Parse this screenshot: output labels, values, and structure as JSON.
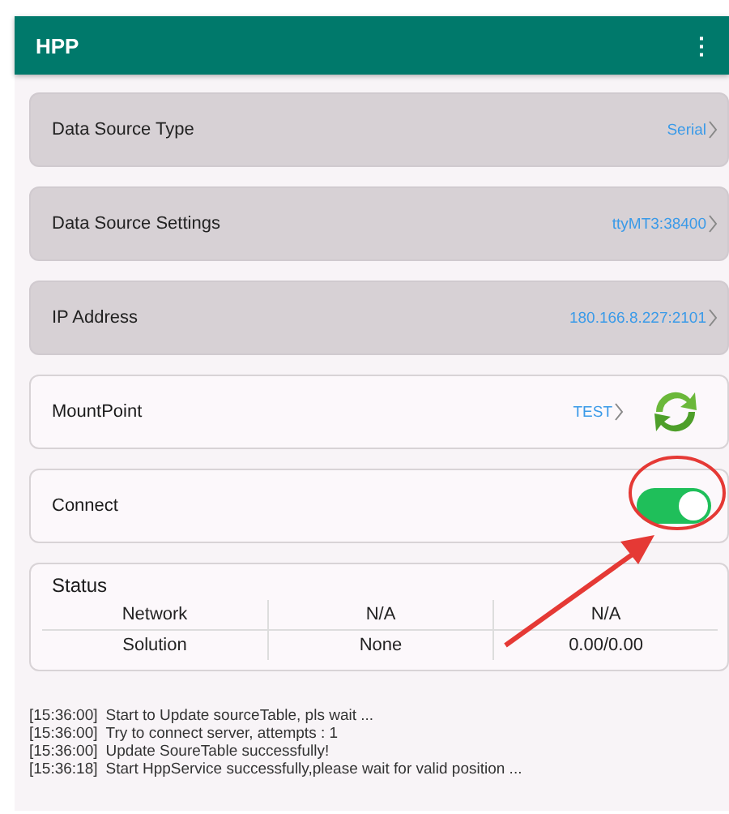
{
  "app_bar": {
    "title": "HPP",
    "menu_icon": "⋮"
  },
  "settings": [
    {
      "kind": "value",
      "label": "Data Source Type",
      "value": "Serial",
      "disabled": true
    },
    {
      "kind": "value",
      "label": "Data Source Settings",
      "value": "ttyMT3:38400",
      "disabled": true
    },
    {
      "kind": "value",
      "label": "IP Address",
      "value": "180.166.8.227:2101",
      "disabled": true
    },
    {
      "kind": "refresh",
      "label": "MountPoint",
      "value": "TEST",
      "disabled": false
    },
    {
      "kind": "toggle",
      "label": "Connect",
      "on": true,
      "disabled": false
    }
  ],
  "status": {
    "title": "Status",
    "rows": [
      {
        "cells": [
          "Network",
          "N/A",
          "N/A"
        ]
      },
      {
        "cells": [
          "Solution",
          "None",
          "0.00/0.00"
        ]
      }
    ]
  },
  "log": [
    {
      "time": "[15:36:00]",
      "message": "Start to Update sourceTable, pls wait ..."
    },
    {
      "time": "[15:36:00]",
      "message": "Try to connect server, attempts : 1"
    },
    {
      "time": "[15:36:00]",
      "message": "Update SoureTable successfully!"
    },
    {
      "time": "[15:36:18]",
      "message": "Start HppService successfully,please wait for valid position ..."
    }
  ]
}
